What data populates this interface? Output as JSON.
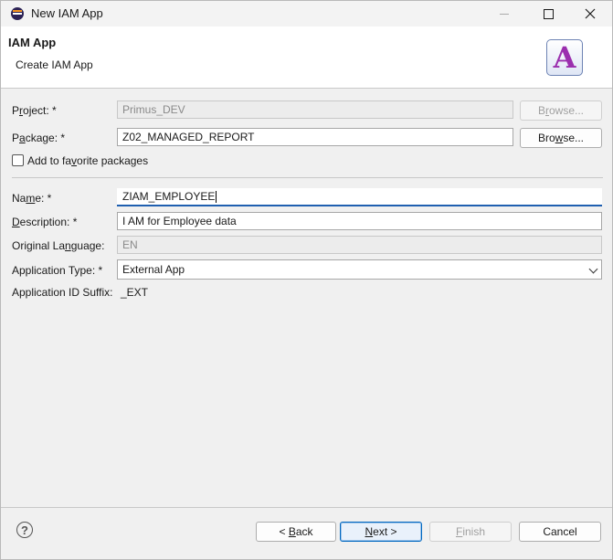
{
  "window": {
    "title": "New IAM App"
  },
  "banner": {
    "title": "IAM App",
    "subtitle": "Create IAM App",
    "icon": "A"
  },
  "form": {
    "project": {
      "label_pre": "P",
      "label_u": "r",
      "label_post": "oject: *",
      "value": "Primus_DEV",
      "browse_pre": "B",
      "browse_u": "r",
      "browse_post": "owse..."
    },
    "package": {
      "label_pre": "P",
      "label_u": "a",
      "label_post": "ckage: *",
      "value": "Z02_MANAGED_REPORT",
      "browse_pre": "Bro",
      "browse_u": "w",
      "browse_post": "se..."
    },
    "favorite": {
      "label_pre": "Add to fa",
      "label_u": "v",
      "label_post": "orite packages"
    },
    "name": {
      "label_pre": "Na",
      "label_u": "m",
      "label_post": "e: *",
      "value": "ZIAM_EMPLOYEE"
    },
    "description": {
      "label_pre": "",
      "label_u": "D",
      "label_post": "escription: *",
      "value": "I AM for Employee data"
    },
    "original_language": {
      "label_pre": "Original La",
      "label_u": "n",
      "label_post": "guage:",
      "value": "EN"
    },
    "application_type": {
      "label": "Application Type: *",
      "value": "External App"
    },
    "application_id_suffix": {
      "label": "Application ID Suffix:",
      "value": "_EXT"
    }
  },
  "buttons": {
    "back": {
      "pre": "< ",
      "u": "B",
      "post": "ack"
    },
    "next": {
      "pre": "",
      "u": "N",
      "post": "ext >"
    },
    "finish": {
      "pre": "",
      "u": "F",
      "post": "inish"
    },
    "cancel": "Cancel"
  },
  "help": "?"
}
